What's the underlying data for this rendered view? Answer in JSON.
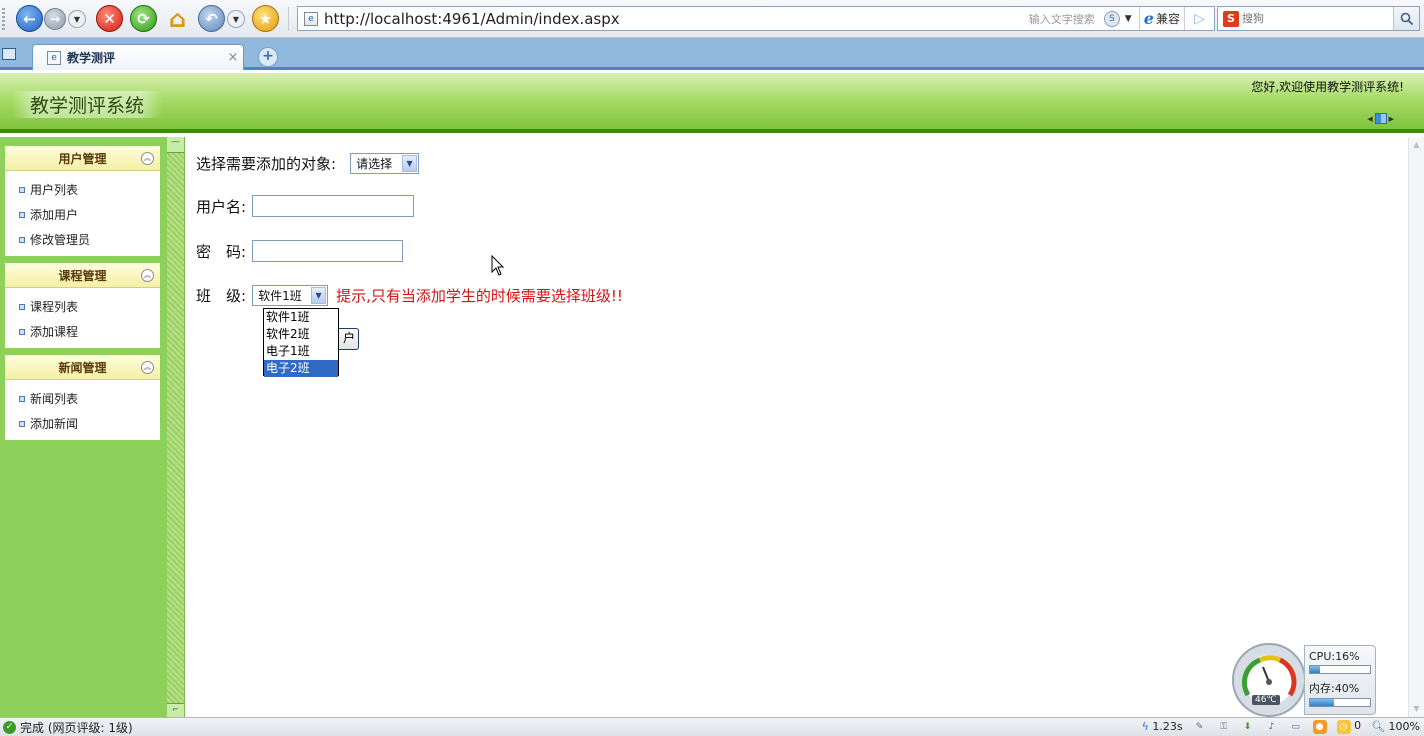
{
  "browser": {
    "url": "http://localhost:4961/Admin/index.aspx",
    "address_hint": "输入文字搜索",
    "compat_label": "兼容",
    "search_placeholder": "搜狗",
    "tab_title": "教学测评",
    "tab_close": "×",
    "new_tab": "+"
  },
  "header": {
    "title": "教学测评系统",
    "welcome": "您好,欢迎使用教学测评系统!"
  },
  "sidebar": {
    "groups": [
      {
        "title": "用户管理",
        "items": [
          "用户列表",
          "添加用户",
          "修改管理员"
        ]
      },
      {
        "title": "课程管理",
        "items": [
          "课程列表",
          "添加课程"
        ]
      },
      {
        "title": "新闻管理",
        "items": [
          "新闻列表",
          "添加新闻"
        ]
      }
    ]
  },
  "form": {
    "object_label": "选择需要添加的对象:",
    "object_selected": "请选择",
    "username_label": "用户名:",
    "username_value": "",
    "password_label": "密　码:",
    "password_value": "",
    "class_label": "班　级:",
    "class_selected": "软件1班",
    "class_options": [
      "软件1班",
      "软件2班",
      "电子1班",
      "电子2班"
    ],
    "class_highlighted_index": 3,
    "class_hint": "提示,只有当添加学生的时候需要选择班级!!",
    "submit_partial": "户"
  },
  "monitor": {
    "cpu_label": "CPU:16%",
    "cpu_percent": 16,
    "mem_label": "内存:40%",
    "mem_percent": 40,
    "temperature": "46℃"
  },
  "statusbar": {
    "text": "完成 (网页评级: 1级)",
    "load_time": "1.23s",
    "counter": "0",
    "zoom": "100%"
  },
  "colors": {
    "header_green": "#7fc33c",
    "sidebar_green": "#8ed15a",
    "hint_red": "#d31515",
    "selection_blue": "#316ac5"
  }
}
